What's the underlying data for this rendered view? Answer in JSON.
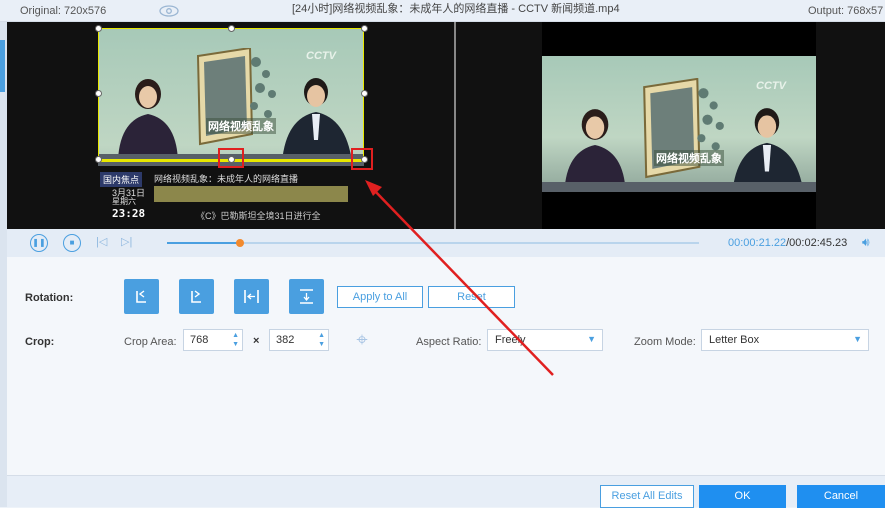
{
  "topbar": {
    "original_label": "Original: 720x576",
    "title": "[24小时]网络视频乱象：未成年人的网络直播 - CCTV 新闻频道.mp4",
    "output_label": "Output: 768x57"
  },
  "video": {
    "channel_logo": "CCTV",
    "screen_caption": "网络视频乱象",
    "ticker_tag": "国内焦点",
    "ticker_headline": "网络视频乱象：未成年人的网络直播",
    "ticker_date": "3月31日",
    "ticker_weekday": "星期六",
    "ticker_time": "23:28",
    "ticker_crawl": "《C》巴勒斯坦全境31日进行全"
  },
  "playback": {
    "current_time": "00:00:21.22",
    "total_time": "/00:02:45.23",
    "progress": 0.14
  },
  "rotation": {
    "label": "Rotation:",
    "apply_all_label": "Apply to All",
    "reset_label": "Reset"
  },
  "crop": {
    "label": "Crop:",
    "area_label": "Crop Area:",
    "width_value": "768",
    "times": "×",
    "height_value": "382",
    "aspect_label": "Aspect Ratio:",
    "aspect_value": "Freely",
    "zoom_label": "Zoom Mode:",
    "zoom_value": "Letter Box"
  },
  "footer": {
    "reset_all_label": "Reset All Edits",
    "ok_label": "OK",
    "cancel_label": "Cancel"
  },
  "colors": {
    "accent": "#4a9fe0",
    "crop_frame": "#e8e800",
    "highlight": "#e02020",
    "progress_knob": "#f28a2e"
  }
}
